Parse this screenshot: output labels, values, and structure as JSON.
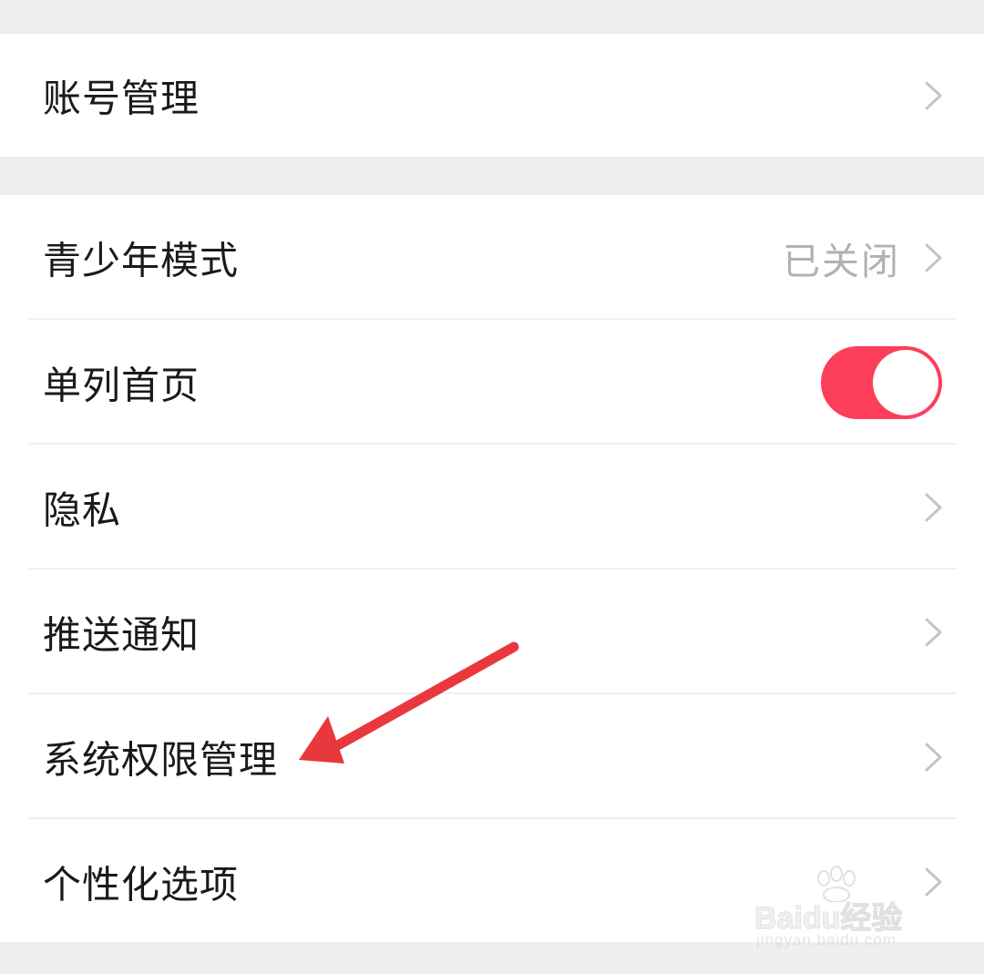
{
  "settings": {
    "account_management": {
      "label": "账号管理"
    },
    "teen_mode": {
      "label": "青少年模式",
      "value": "已关闭"
    },
    "single_column_home": {
      "label": "单列首页",
      "enabled": true
    },
    "privacy": {
      "label": "隐私"
    },
    "push_notifications": {
      "label": "推送通知"
    },
    "system_permissions": {
      "label": "系统权限管理"
    },
    "personalization": {
      "label": "个性化选项"
    }
  },
  "annotation": {
    "arrow_color": "#e8383d"
  },
  "watermark": {
    "brand": "Baidu经验",
    "url": "jingyan.baidu.com"
  },
  "colors": {
    "toggle_on": "#fd3e5b",
    "background": "#efeff1",
    "chevron": "#c4c4c4",
    "secondary_text": "#b2b2b2"
  }
}
